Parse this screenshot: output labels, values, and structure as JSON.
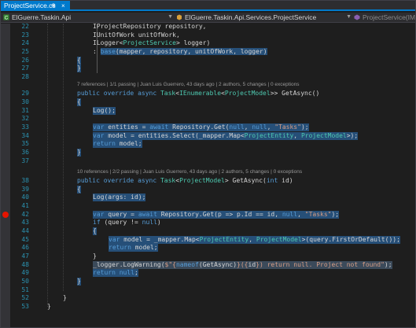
{
  "tab": {
    "title": "ProjectService.cs",
    "pin": "⊕",
    "close": "×"
  },
  "navbar": {
    "project": "ElGuerre.Taskin.Api",
    "class": "ElGuerre.Taskin.Api.Services.ProjectService",
    "member": "ProjectService(IMa"
  },
  "editor": {
    "line_numbers": [
      "22",
      "23",
      "24",
      "25",
      "26",
      "27",
      "28",
      "29",
      "30",
      "31",
      "32",
      "33",
      "34",
      "35",
      "36",
      "37",
      "38",
      "39",
      "40",
      "41",
      "42",
      "43",
      "44",
      "45",
      "46",
      "47",
      "48",
      "49",
      "50",
      "51",
      "52",
      "53"
    ],
    "codelens": [
      "7 references | 1/1 passing | Juan Luis Guerrero, 43 days ago | 2 authors, 5 changes | 0 exceptions",
      "10 references | 2/2 passing | Juan Luis Guerrero, 43 days ago | 2 authors, 5 changes | 0 exceptions"
    ],
    "breakpoint_line": "42",
    "colors": {
      "background": "#1e1e1e",
      "selection": "#264f78",
      "keyword": "#569cd6",
      "type": "#4ec9b0",
      "string": "#d69d85",
      "breakpoint": "#e51400",
      "accent": "#007acc"
    }
  }
}
